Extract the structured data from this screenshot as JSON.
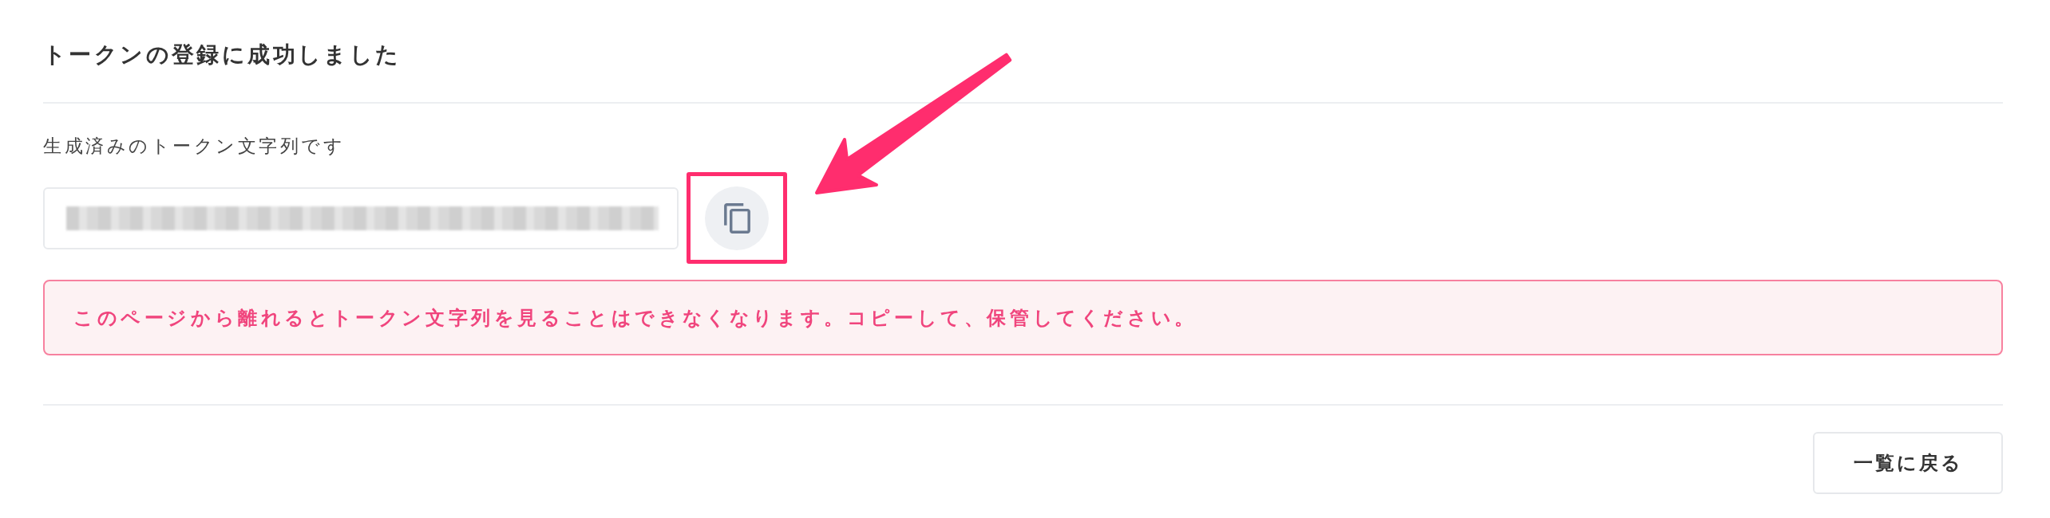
{
  "title": "トークンの登録に成功しました",
  "token": {
    "label": "生成済みのトークン文字列です"
  },
  "copy_button": {
    "highlighted": true
  },
  "alert": {
    "message": "このページから離れるとトークン文字列を見ることはできなくなります。コピーして、保管してください。"
  },
  "footer": {
    "buttons": [
      "一覧に戻る"
    ]
  }
}
